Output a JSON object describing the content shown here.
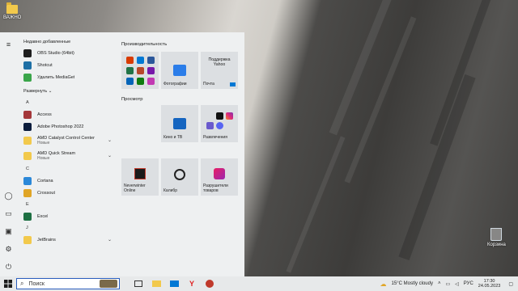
{
  "desktop": {
    "folder_label": "ВАЖНО",
    "recycle_bin_label": "Корзина"
  },
  "start_menu": {
    "recent_heading": "Недавно добавленные",
    "recent": [
      {
        "label": "OBS Studio (64bit)",
        "icon": "obs-icon",
        "color": "#1e1e1e"
      },
      {
        "label": "Shotcut",
        "icon": "shotcut-icon",
        "color": "#1d6fa5"
      },
      {
        "label": "Удалить MediaGet",
        "icon": "mediaget-icon",
        "color": "#3aa54a"
      }
    ],
    "expand_label": "Развернуть",
    "sections": [
      {
        "letter": "A",
        "apps": [
          {
            "label": "Access",
            "sub": "",
            "icon": "access-icon",
            "color": "#a4373a",
            "chev": false
          },
          {
            "label": "Adobe Photoshop 2022",
            "sub": "",
            "icon": "photoshop-icon",
            "color": "#0b1c3c",
            "chev": false
          },
          {
            "label": "AMD Catalyst Control Center",
            "sub": "Новые",
            "icon": "folder-icon",
            "color": "#f2c94c",
            "chev": true
          },
          {
            "label": "AMD Quick Stream",
            "sub": "Новые",
            "icon": "folder-icon",
            "color": "#f2c94c",
            "chev": true
          }
        ]
      },
      {
        "letter": "C",
        "apps": [
          {
            "label": "Cortana",
            "sub": "",
            "icon": "cortana-icon",
            "color": "#2b88d8",
            "chev": false
          },
          {
            "label": "Crossout",
            "sub": "",
            "icon": "crossout-icon",
            "color": "#e0a526",
            "chev": false
          }
        ]
      },
      {
        "letter": "E",
        "apps": [
          {
            "label": "Excel",
            "sub": "",
            "icon": "excel-icon",
            "color": "#1d6f42",
            "chev": false
          }
        ]
      },
      {
        "letter": "J",
        "apps": [
          {
            "label": "JetBrains",
            "sub": "",
            "icon": "folder-icon",
            "color": "#f2c94c",
            "chev": true
          }
        ]
      }
    ],
    "groups": {
      "productivity_title": "Производительность",
      "browse_title": "Просмотр"
    },
    "tiles": {
      "photos": "Фотографии",
      "yahoo_line1": "Поддержка",
      "yahoo_line2": "Yahoo",
      "mail": "Почта",
      "movies": "Кино и ТВ",
      "entertainment": "Развлечения",
      "neverwinter_line1": "Neverwinter",
      "neverwinter_line2": "Online",
      "caliber": "Калибр",
      "warships_line1": "Разрушители",
      "warships_line2": "товаров"
    }
  },
  "taskbar": {
    "search_placeholder": "Поиск",
    "weather": "15°C  Mostly cloudy",
    "lang": "РУС",
    "time": "17:30",
    "date": "24.05.2023"
  }
}
